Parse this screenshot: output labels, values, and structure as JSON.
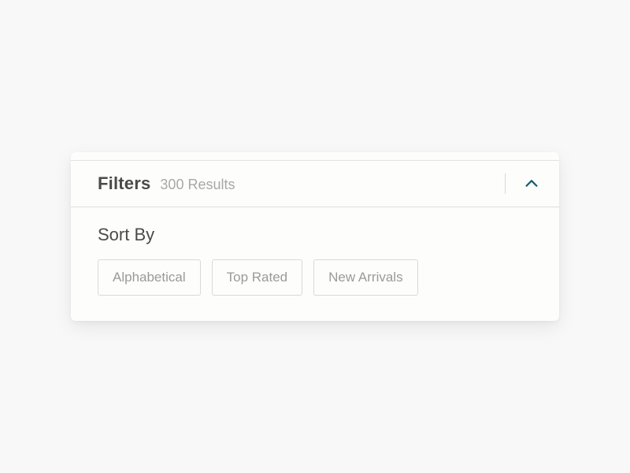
{
  "panel": {
    "title": "Filters",
    "results_text": "300 Results",
    "sort_label": "Sort By",
    "sort_options": [
      "Alphabetical",
      "Top Rated",
      "New Arrivals"
    ]
  }
}
